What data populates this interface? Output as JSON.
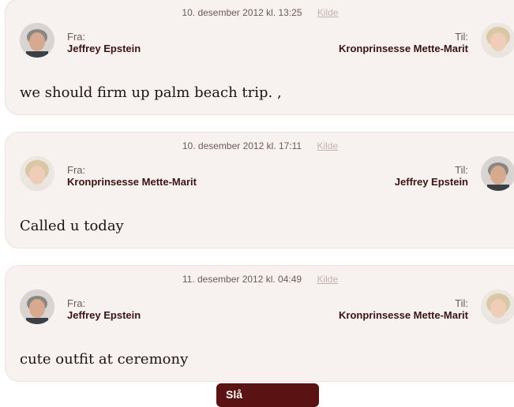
{
  "messages": [
    {
      "date": "10. desember 2012 kl. 13:25",
      "source": "Kilde",
      "from_label": "Fra:",
      "from_name": "Jeffrey Epstein",
      "to_label": "Til:",
      "to_name": "Kronprinsesse Mette-Marit",
      "text": "we should firm up palm beach trip. ,"
    },
    {
      "date": "10. desember 2012 kl. 17:11",
      "source": "Kilde",
      "from_label": "Fra:",
      "from_name": "Kronprinsesse Mette-Marit",
      "to_label": "Til:",
      "to_name": "Jeffrey Epstein",
      "text": "Called u today"
    },
    {
      "date": "11. desember 2012 kl. 04:49",
      "source": "Kilde",
      "from_label": "Fra:",
      "from_name": "Jeffrey Epstein",
      "to_label": "Til:",
      "to_name": "Kronprinsesse Mette-Marit",
      "text": "cute outfit at ceremony"
    }
  ],
  "button": {
    "label": "Slå"
  },
  "colors": {
    "card_bg": "#f7f1ef",
    "name_text": "#3a1414",
    "button_bg": "#5a1212",
    "link_muted": "#c4b3b0"
  },
  "icons": {
    "male_avatar": "avatar-jeffrey-epstein",
    "female_avatar": "avatar-mette-marit"
  }
}
